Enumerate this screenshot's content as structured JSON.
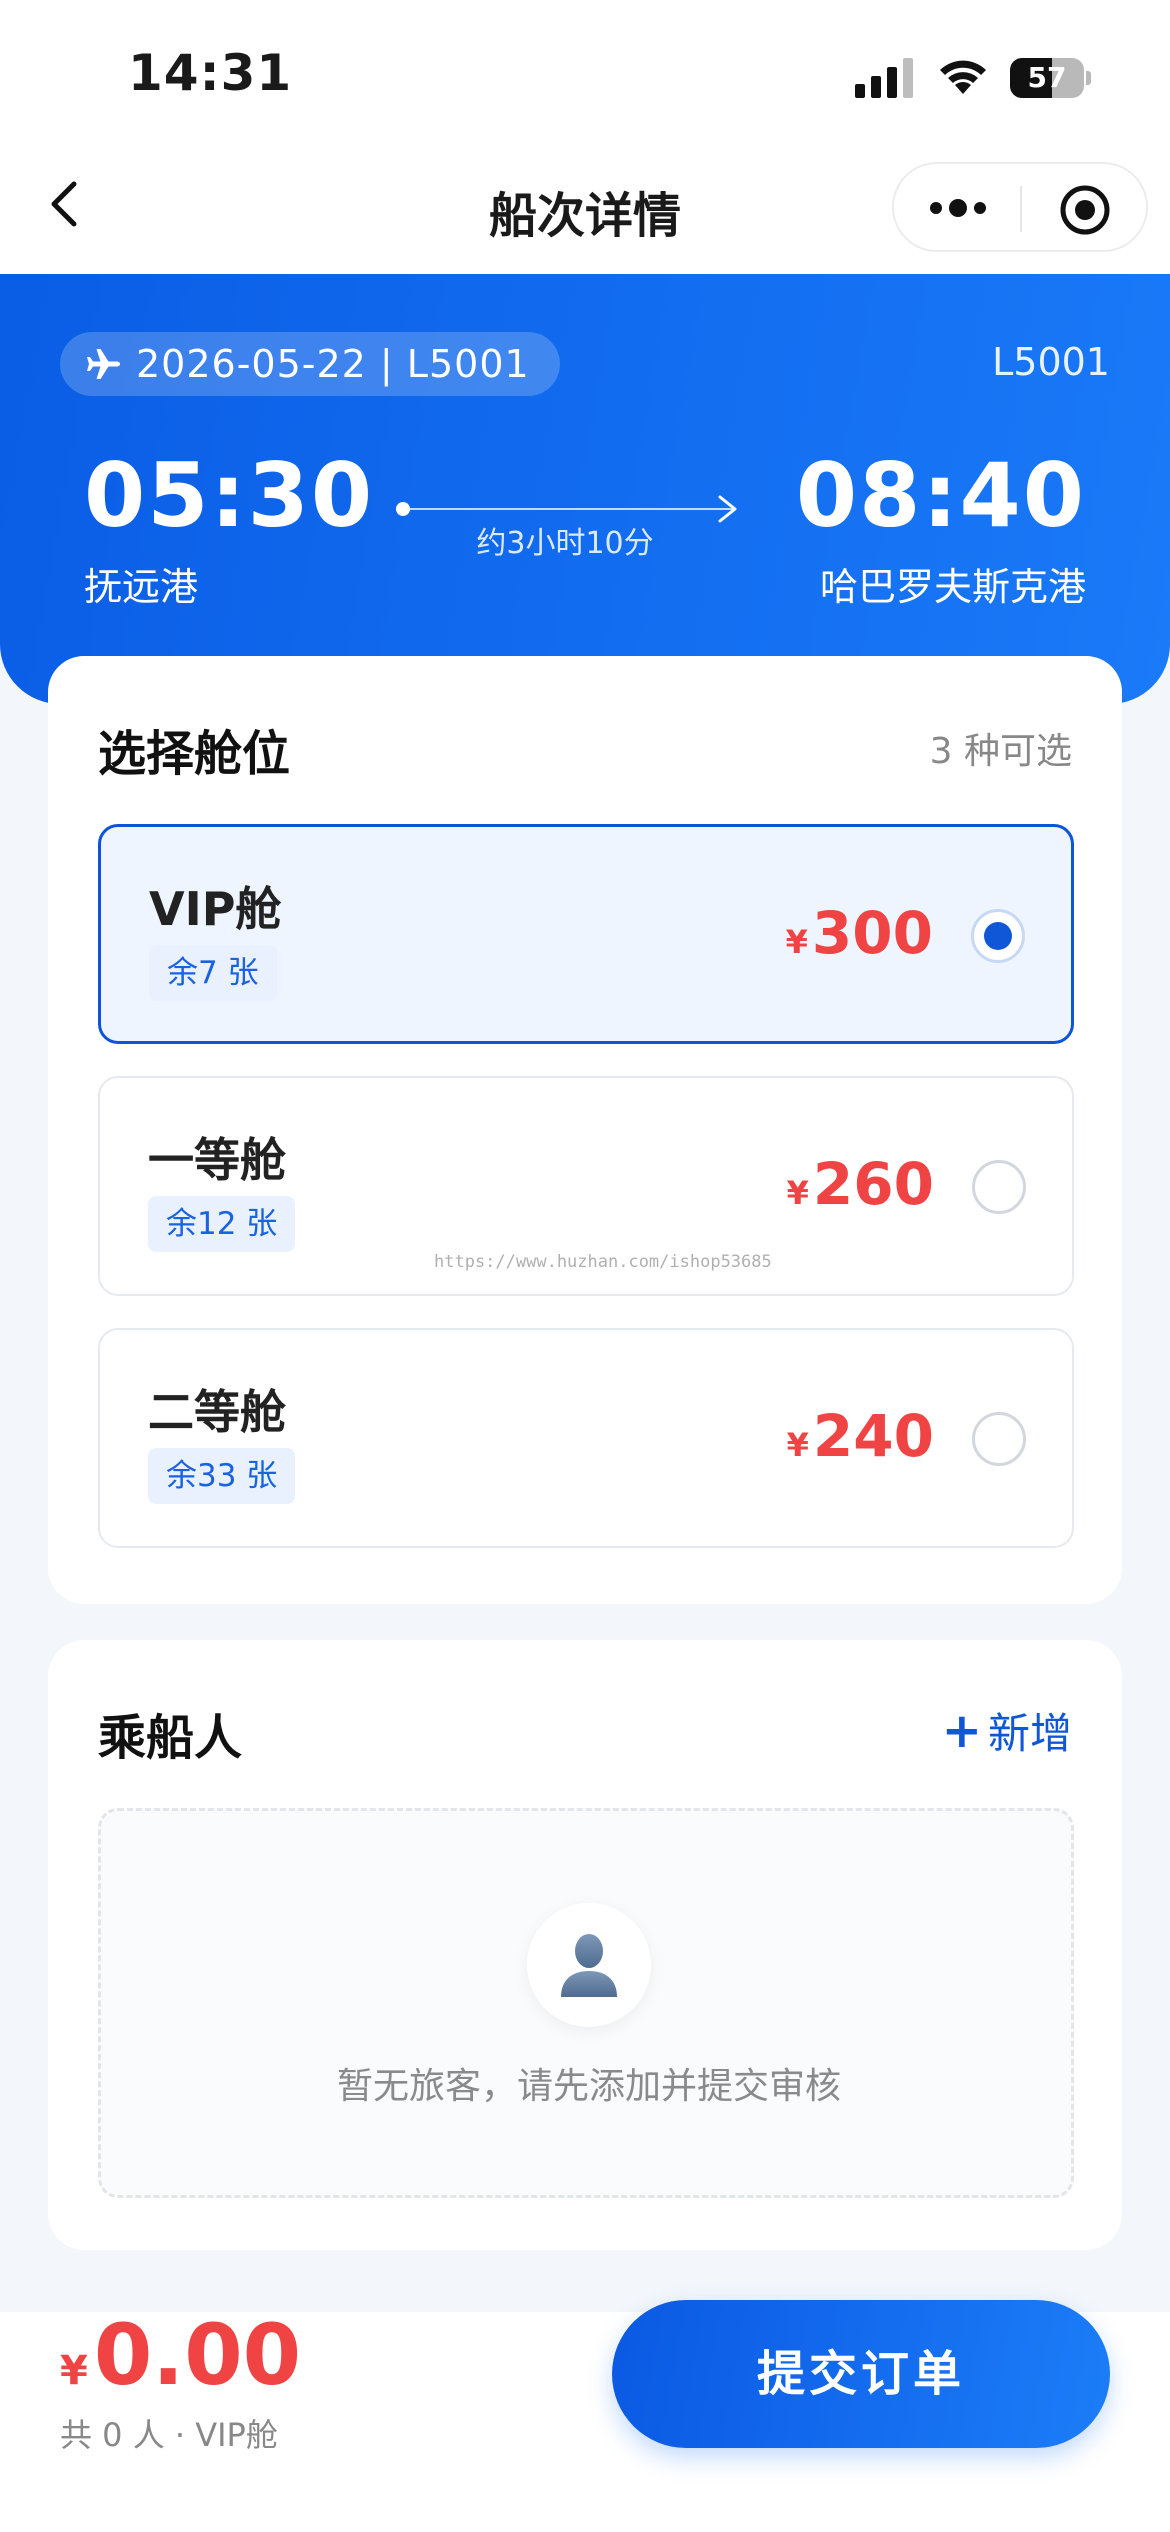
{
  "status_bar": {
    "time": "14:31",
    "battery": "57",
    "battery_level": 0.57
  },
  "nav": {
    "title": "船次详情"
  },
  "hero": {
    "date_code": "2026-05-22 | L5001",
    "code": "L5001",
    "depart_time": "05:30",
    "arrive_time": "08:40",
    "depart_port": "抚远港",
    "arrive_port": "哈巴罗夫斯克港",
    "duration": "约3小时10分"
  },
  "cabins": {
    "title": "选择舱位",
    "count_text": "3 种可选",
    "currency": "¥",
    "items": [
      {
        "name": "VIP舱",
        "remain": "余7 张",
        "price": "300",
        "selected": true
      },
      {
        "name": "一等舱",
        "remain": "余12 张",
        "price": "260",
        "selected": false
      },
      {
        "name": "二等舱",
        "remain": "余33 张",
        "price": "240",
        "selected": false
      }
    ],
    "watermark": "https://www.huzhan.com/ishop53685"
  },
  "passengers": {
    "title": "乘船人",
    "add_label": "新增",
    "empty_text": "暂无旅客，请先添加并提交审核"
  },
  "footer": {
    "currency": "¥",
    "total": "0.00",
    "summary": "共 0 人 · VIP舱",
    "submit_label": "提交订单"
  },
  "colors": {
    "primary": "#0d55d6",
    "price": "#f04444",
    "hero_start": "#0a5de5",
    "hero_end": "#1a7af8"
  }
}
